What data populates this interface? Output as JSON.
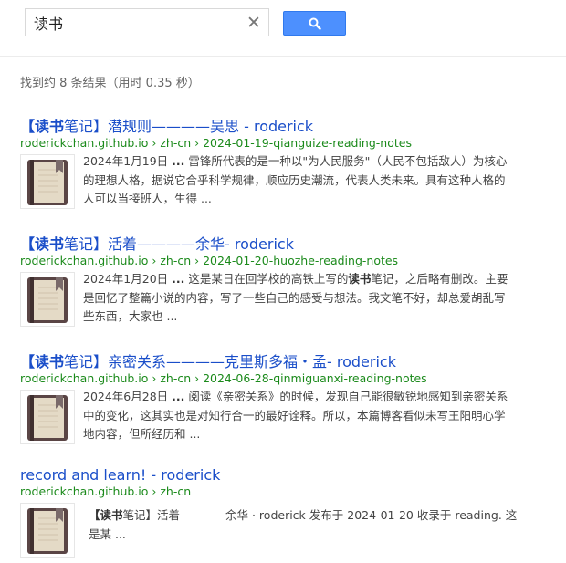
{
  "search": {
    "query": "读书",
    "clear_symbol": "✕"
  },
  "stats": {
    "text": "找到约 8 条结果（用时 0.35 秒）"
  },
  "results": [
    {
      "title_bold": "【读书",
      "title_rest": "笔记】潜规则————吴思 - roderick",
      "url": "roderickchan.github.io › zh-cn › 2024-01-19-qianguize-reading-notes",
      "date": "2024年1月19日",
      "ellipsis": "...",
      "snippet": " 雷锋所代表的是一种以\"为人民服务\"（人民不包括敌人）为核心的理想人格，据说它合乎科学规律，顺应历史潮流，代表人类未来。具有这种人格的人可以当接班人，生得 ..."
    },
    {
      "title_bold": "【读书",
      "title_rest": "笔记】活着————余华- roderick",
      "url": "roderickchan.github.io › zh-cn › 2024-01-20-huozhe-reading-notes",
      "date": "2024年1月20日",
      "ellipsis": "...",
      "snippet_a": " 这是某日在回学校的高铁上写的",
      "snippet_bold": "读书",
      "snippet_b": "笔记，之后略有删改。主要是回忆了整篇小说的内容，写了一些自己的感受与想法。我文笔不好，却总爱胡乱写些东西，大家也 ..."
    },
    {
      "title_bold": "【读书",
      "title_rest": "笔记】亲密关系————克里斯多福・孟- roderick",
      "url": "roderickchan.github.io › zh-cn › 2024-06-28-qinmiguanxi-reading-notes",
      "date": "2024年6月28日",
      "ellipsis": "...",
      "snippet": " 阅读《亲密关系》的时候，发现自己能很敏锐地感知到亲密关系中的变化，这其实也是对知行合一的最好诠释。所以，本篇博客看似未写王阳明心学地内容，但所经历和 ..."
    },
    {
      "title": "record and learn! - roderick",
      "url": "roderickchan.github.io › zh-cn",
      "snippet_bold": "【读书",
      "snippet_rest": "笔记】活着————余华 · roderick 发布于 2024-01-20 收录于 reading. 这是某 ..."
    }
  ],
  "colors": {
    "title": "#1a4ec9",
    "url": "#1b8a1b",
    "button": "#4d90fe"
  }
}
